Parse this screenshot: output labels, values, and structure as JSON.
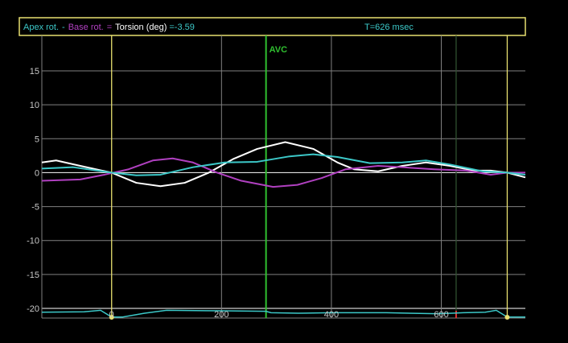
{
  "header": {
    "apex_label": "Apex rot.",
    "minus": "-",
    "base_label": "Base rot.",
    "equals": "=",
    "torsion_label": "Torsion (deg)",
    "value": "=-3.59",
    "time": "T=626 msec"
  },
  "colors": {
    "apex": "#3cc8c8",
    "base": "#b040c0",
    "torsion": "#ffffff",
    "frame": "#e8e070",
    "avc": "#30c030",
    "grid": "#909090",
    "cursor": "#305030"
  },
  "chart_data": {
    "type": "line",
    "title": "Apex rot. - Base rot. = Torsion (deg) =-3.59",
    "xlabel": "msec",
    "ylabel": "deg",
    "xlim": [
      -127,
      753
    ],
    "ylim": [
      -20,
      15
    ],
    "y_ticks": [
      15,
      10,
      5,
      0,
      -5,
      -10,
      -15,
      -20
    ],
    "y_tick_labels": [
      "15",
      "10",
      "5",
      "0",
      "-5",
      "-10",
      "-15",
      "-20"
    ],
    "x_ticks": [
      0,
      200,
      400,
      600
    ],
    "x_tick_labels": [
      "0",
      "200",
      "400",
      "600"
    ],
    "grid": true,
    "markers": [
      {
        "name": "start",
        "x": 0,
        "color": "#e8e070"
      },
      {
        "name": "AVC",
        "label": "AVC",
        "x": 281,
        "color": "#30c030"
      },
      {
        "name": "cursor",
        "x": 627,
        "color": "#305030"
      },
      {
        "name": "end",
        "x": 720,
        "color": "#e8e070"
      }
    ],
    "series": [
      {
        "name": "Torsion",
        "color": "#ffffff",
        "x": [
          -127,
          -101,
          -57,
          0,
          45,
          89,
          133,
          177,
          221,
          265,
          316,
          367,
          411,
          441,
          485,
          529,
          572,
          616,
          660,
          690,
          720,
          753
        ],
        "y": [
          1.5,
          1.8,
          1.0,
          0,
          -1.5,
          -2.0,
          -1.5,
          0,
          2,
          3.5,
          4.5,
          3.5,
          1.5,
          0.5,
          0.2,
          1,
          1.5,
          1,
          0.3,
          0.3,
          0,
          -0.7
        ]
      },
      {
        "name": "Base rot.",
        "color": "#b040c0",
        "x": [
          -127,
          -57,
          -13,
          31,
          75,
          111,
          148,
          192,
          236,
          294,
          338,
          382,
          426,
          485,
          529,
          587,
          646,
          690,
          720,
          753
        ],
        "y": [
          -1.2,
          -1,
          -0.3,
          0.5,
          1.8,
          2.1,
          1.5,
          0,
          -1.2,
          -2.1,
          -1.8,
          -0.8,
          0.5,
          1,
          0.8,
          0.5,
          0.3,
          -0.3,
          0,
          0
        ]
      },
      {
        "name": "Apex rot.",
        "color": "#3cc8c8",
        "x": [
          -127,
          -70,
          0,
          45,
          89,
          148,
          206,
          265,
          324,
          367,
          411,
          470,
          529,
          572,
          616,
          675,
          720,
          753
        ],
        "y": [
          0.6,
          0.8,
          0,
          -0.4,
          -0.3,
          0.8,
          1.5,
          1.6,
          2.4,
          2.7,
          2.3,
          1.4,
          1.5,
          1.8,
          1.2,
          0.2,
          0,
          -0.3
        ]
      }
    ],
    "ecg": {
      "x": [
        -127,
        -50,
        -20,
        0,
        20,
        60,
        100,
        200,
        281,
        290,
        340,
        400,
        500,
        590,
        620,
        640,
        680,
        700,
        720,
        753
      ],
      "y": [
        0.6,
        0.65,
        0.8,
        0.1,
        0.1,
        0.5,
        0.8,
        0.75,
        0.7,
        0.55,
        0.5,
        0.55,
        0.55,
        0.45,
        0.5,
        0.55,
        0.6,
        0.8,
        0.1,
        0.1
      ]
    }
  }
}
